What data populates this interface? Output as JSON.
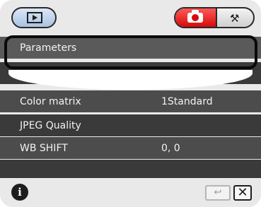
{
  "toolbar": {
    "play_icon": "play-icon",
    "camera_icon": "camera-icon",
    "tools_icon": "wrench-icon",
    "tools_glyph": "⚒"
  },
  "list": {
    "rows": [
      {
        "label": "Parameters",
        "value": ""
      },
      {
        "label": "",
        "value": ""
      },
      {
        "label": "Color matrix",
        "value": "1Standard"
      },
      {
        "label": "JPEG Quality",
        "value": ""
      },
      {
        "label": "WB SHIFT",
        "value": "0, 0"
      }
    ]
  },
  "bottom": {
    "info_label": "i",
    "undo_label": "↩",
    "close_label": "✕"
  },
  "colors": {
    "accent": "#d50a0a",
    "row_dark": "#3a3a3a",
    "row_mid": "#4c4c4c"
  }
}
